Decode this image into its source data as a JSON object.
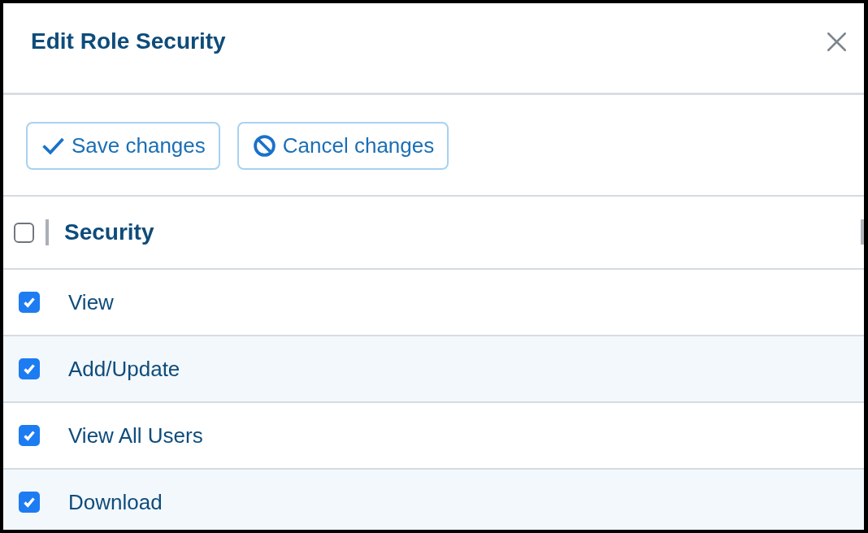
{
  "dialog": {
    "title": "Edit Role Security"
  },
  "toolbar": {
    "buttons": [
      {
        "label": "Save changes",
        "kind": "save"
      },
      {
        "label": "Cancel changes",
        "kind": "cancel"
      }
    ]
  },
  "table": {
    "header": {
      "label": "Security",
      "checked": false
    },
    "rows": [
      {
        "label": "View",
        "checked": true
      },
      {
        "label": "Add/Update",
        "checked": true
      },
      {
        "label": "View All Users",
        "checked": true
      },
      {
        "label": "Download",
        "checked": true
      }
    ]
  }
}
